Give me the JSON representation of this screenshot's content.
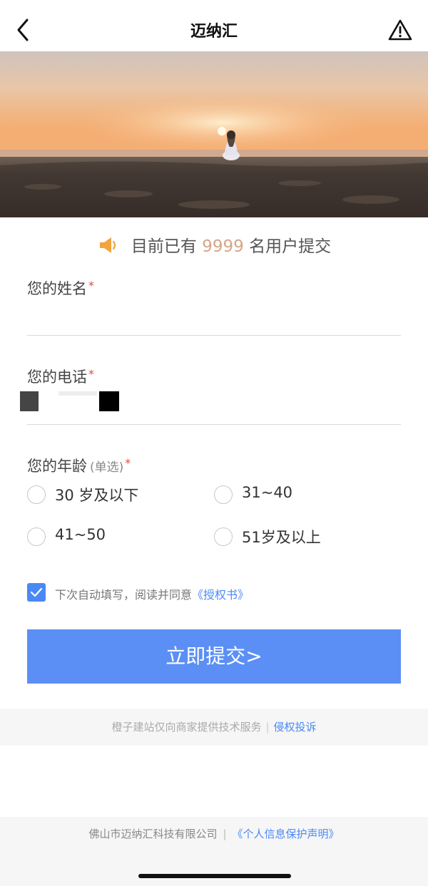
{
  "nav": {
    "title": "迈纳汇",
    "back_icon": "chevron-left-icon",
    "report_icon": "warning-triangle-icon"
  },
  "notice": {
    "icon": "speaker-icon",
    "prefix": "目前已有",
    "count": "9999",
    "suffix": "名用户提交",
    "count_color": "#d7a488"
  },
  "form": {
    "name": {
      "label": "您的姓名",
      "required": "*",
      "value": ""
    },
    "phone": {
      "label": "您的电话",
      "required": "*",
      "value": ""
    },
    "age": {
      "label": "您的年龄",
      "hint": "(单选)",
      "required": "*",
      "options": [
        "30 岁及以下",
        "31~40",
        "41~50",
        "51岁及以上"
      ]
    },
    "agree": {
      "checked": true,
      "text": "下次自动填写，阅读并同意",
      "link": "《授权书》"
    },
    "submit_label": "立即提交>"
  },
  "service_bar": {
    "text": "橙子建站仅向商家提供技术服务",
    "separator": "|",
    "link": "侵权投诉"
  },
  "footer": {
    "company": "佛山市迈纳汇科技有限公司",
    "separator": "|",
    "link": "《个人信息保护声明》"
  },
  "colors": {
    "accent": "#4a89f5",
    "submit_bg": "#5b8ff5",
    "required": "#e5483b"
  }
}
